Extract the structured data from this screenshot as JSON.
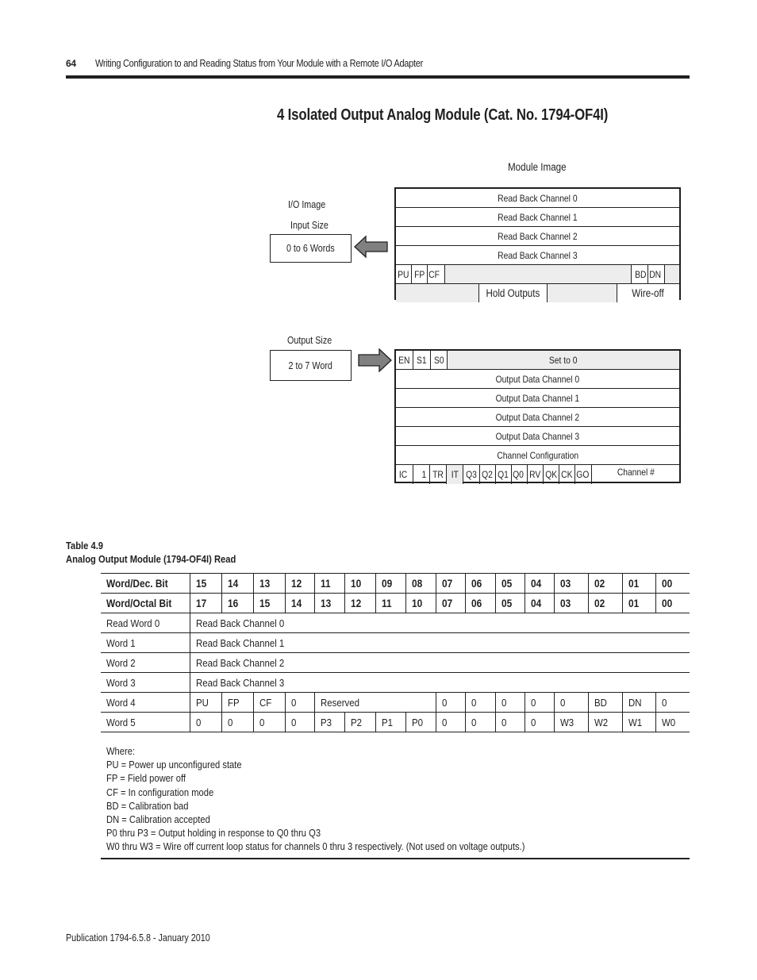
{
  "header": {
    "page_number": "64",
    "running_title": "Writing Configuration to and Reading Status from Your Module with a Remote I/O Adapter"
  },
  "section_title": "4 Isolated Output Analog Module (Cat. No. 1794-OF4I)",
  "diagram": {
    "module_image_label": "Module Image",
    "io_image_label": "I/O Image",
    "input_size_label": "Input Size",
    "input_size_value": "0 to 6 Words",
    "output_size_label": "Output Size",
    "output_size_value": "2 to 7 Word",
    "arrow_color": "#808080",
    "input_words": [
      "Read Back Channel 0",
      "Read Back Channel 1",
      "Read Back Channel 2",
      "Read Back Channel 3"
    ],
    "status_word_bits": [
      "PU",
      "FP",
      "CF",
      "BD",
      "DN"
    ],
    "status_word2": {
      "hold_outputs": "Hold  Outputs",
      "wire_off": "Wire-off"
    },
    "output_word0_bits": [
      "EN",
      "S1",
      "S0"
    ],
    "output_word0_rest": "Set to 0",
    "output_words": [
      "Output Data Channel 0",
      "Output Data Channel 1",
      "Output Data Channel 2",
      "Output Data Channel 3",
      "Channel Configuration"
    ],
    "config_bits": [
      "IC",
      "1",
      "TR",
      "IT",
      "Q3",
      "Q2",
      "Q1",
      "Q0",
      "RV",
      "QK",
      "CK",
      "GO"
    ],
    "config_channel_label": "Channel #"
  },
  "table": {
    "number": "Table 4.9",
    "title": "Analog Output Module (1794-OF4I) Read",
    "dec_header": {
      "label": "Word/Dec. Bit",
      "bits": [
        "15",
        "14",
        "13",
        "12",
        "11",
        "10",
        "09",
        "08",
        "07",
        "06",
        "05",
        "04",
        "03",
        "02",
        "01",
        "00"
      ]
    },
    "octal_header": {
      "label": "Word/Octal Bit",
      "bits": [
        "17",
        "16",
        "15",
        "14",
        "13",
        "12",
        "11",
        "10",
        "07",
        "06",
        "05",
        "04",
        "03",
        "02",
        "01",
        "00"
      ]
    },
    "rows": [
      {
        "word": "Read Word 0",
        "content": "Read Back Channel 0"
      },
      {
        "word": "Word 1",
        "content": "Read Back Channel 1"
      },
      {
        "word": "Word 2",
        "content": "Read Back Channel 2"
      },
      {
        "word": "Word 3",
        "content": "Read Back Channel 3"
      }
    ],
    "word4": {
      "word": "Word 4",
      "cells": [
        "PU",
        "FP",
        "CF",
        "0",
        "Reserved",
        "0",
        "0",
        "0",
        "0",
        "0",
        "BD",
        "DN",
        "0"
      ]
    },
    "word5": {
      "word": "Word 5",
      "cells": [
        "0",
        "0",
        "0",
        "0",
        "P3",
        "P2",
        "P1",
        "P0",
        "0",
        "0",
        "0",
        "0",
        "W3",
        "W2",
        "W1",
        "W0"
      ]
    },
    "notes": [
      "Where:",
      "PU = Power up unconfigured state",
      "FP = Field power off",
      "CF = In configuration mode",
      "BD = Calibration bad",
      "DN = Calibration accepted",
      "P0 thru P3 = Output holding in response to Q0 thru Q3",
      "W0 thru W3 = Wire off current loop status for channels 0 thru 3 respectively. (Not used on voltage outputs.)"
    ]
  },
  "footer": "Publication 1794-6.5.8 - January 2010"
}
